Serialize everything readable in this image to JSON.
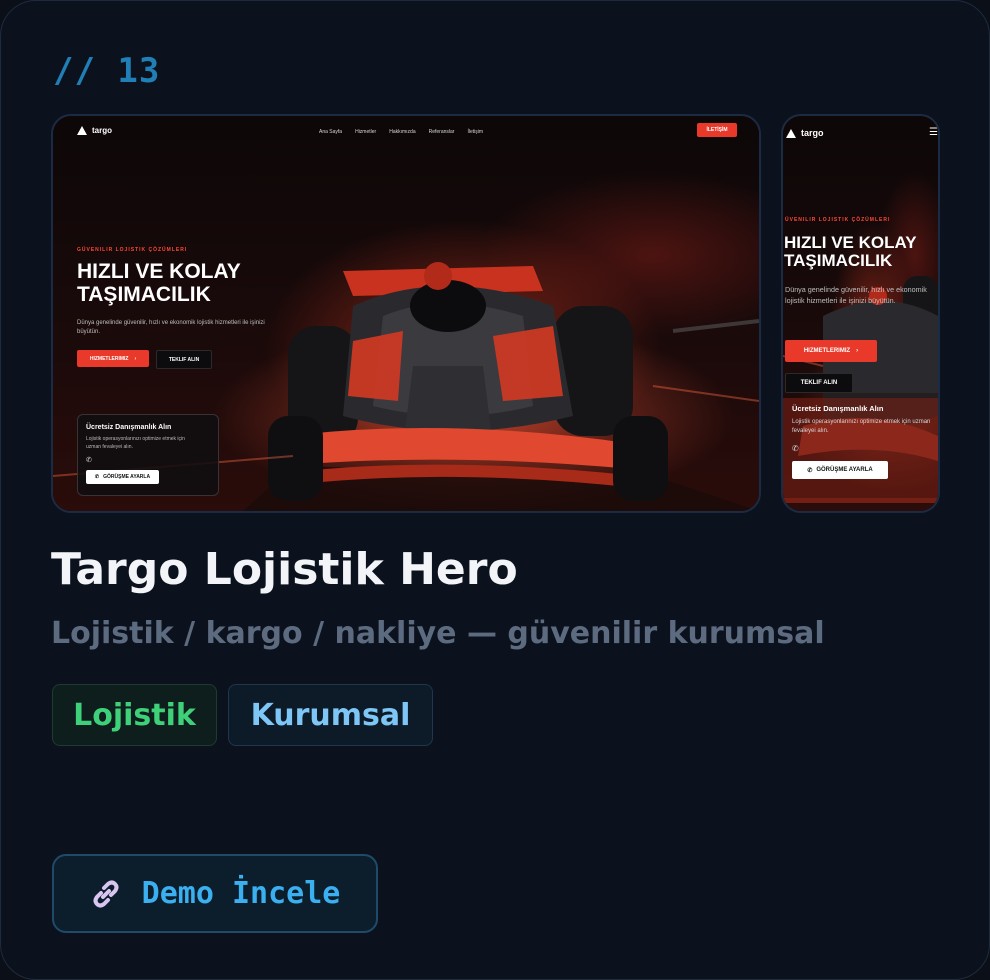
{
  "card": {
    "number": "// 13"
  },
  "preview_desktop": {
    "logo": "targo",
    "nav_links": [
      "Ana Sayfa",
      "Hizmetler",
      "Hakkımızda",
      "Referanslar",
      "İletişim"
    ],
    "nav_cta": "İLETİŞİM",
    "kicker": "GÜVENILIR LOJISTIK ÇÖZÜMLERI",
    "headline_line1": "HIZLI VE KOLAY",
    "headline_line2": "TAŞIMACILIK",
    "description": "Dünya genelinde güvenilir, hızlı ve ekonomik lojistik hizmetleri ile işinizi büyütün.",
    "primary_button": "HIZMETLERIMIZ",
    "secondary_button": "TEKLIF ALIN",
    "panel_title": "Ücretsiz Danışmanlık Alın",
    "panel_text": "Lojistik operasyonlarınızı optimize etmek için uzman fevaleyei alın.",
    "panel_button": "GÖRÜŞME AYARLA"
  },
  "preview_mobile": {
    "logo": "targo",
    "kicker": "ÜVENILIR LOJISTIK ÇÖZÜMLERI",
    "headline_line1": "HIZLI VE KOLAY",
    "headline_line2": "TAŞIMACILIK",
    "description": "Dünya genelinde güvenilir, hızlı ve ekonomik lojistik hizmetleri ile işinizi büyütün.",
    "primary_button": "HIZMETLERIMIZ",
    "secondary_button": "TEKLIF ALIN",
    "panel_title": "Ücretsiz Danışmanlık Alın",
    "panel_text": "Lojistik operasyonlarınızı optimize etmek için uzman fevaleyei alın.",
    "panel_button": "GÖRÜŞME AYARLA"
  },
  "title": "Targo Lojistik Hero",
  "subtitle": "Lojistik / kargo / nakliye — güvenilir kurumsal",
  "tags": [
    "Lojistik",
    "Kurumsal"
  ],
  "demo_button": {
    "label": "Demo İncele",
    "icon": "link-icon"
  },
  "colors": {
    "accent_red": "#e8392a",
    "tag_green": "#3fd07a",
    "tag_blue": "#7dc6f6",
    "demo_blue": "#3ab0f0",
    "number_blue": "#1f7fb6"
  }
}
